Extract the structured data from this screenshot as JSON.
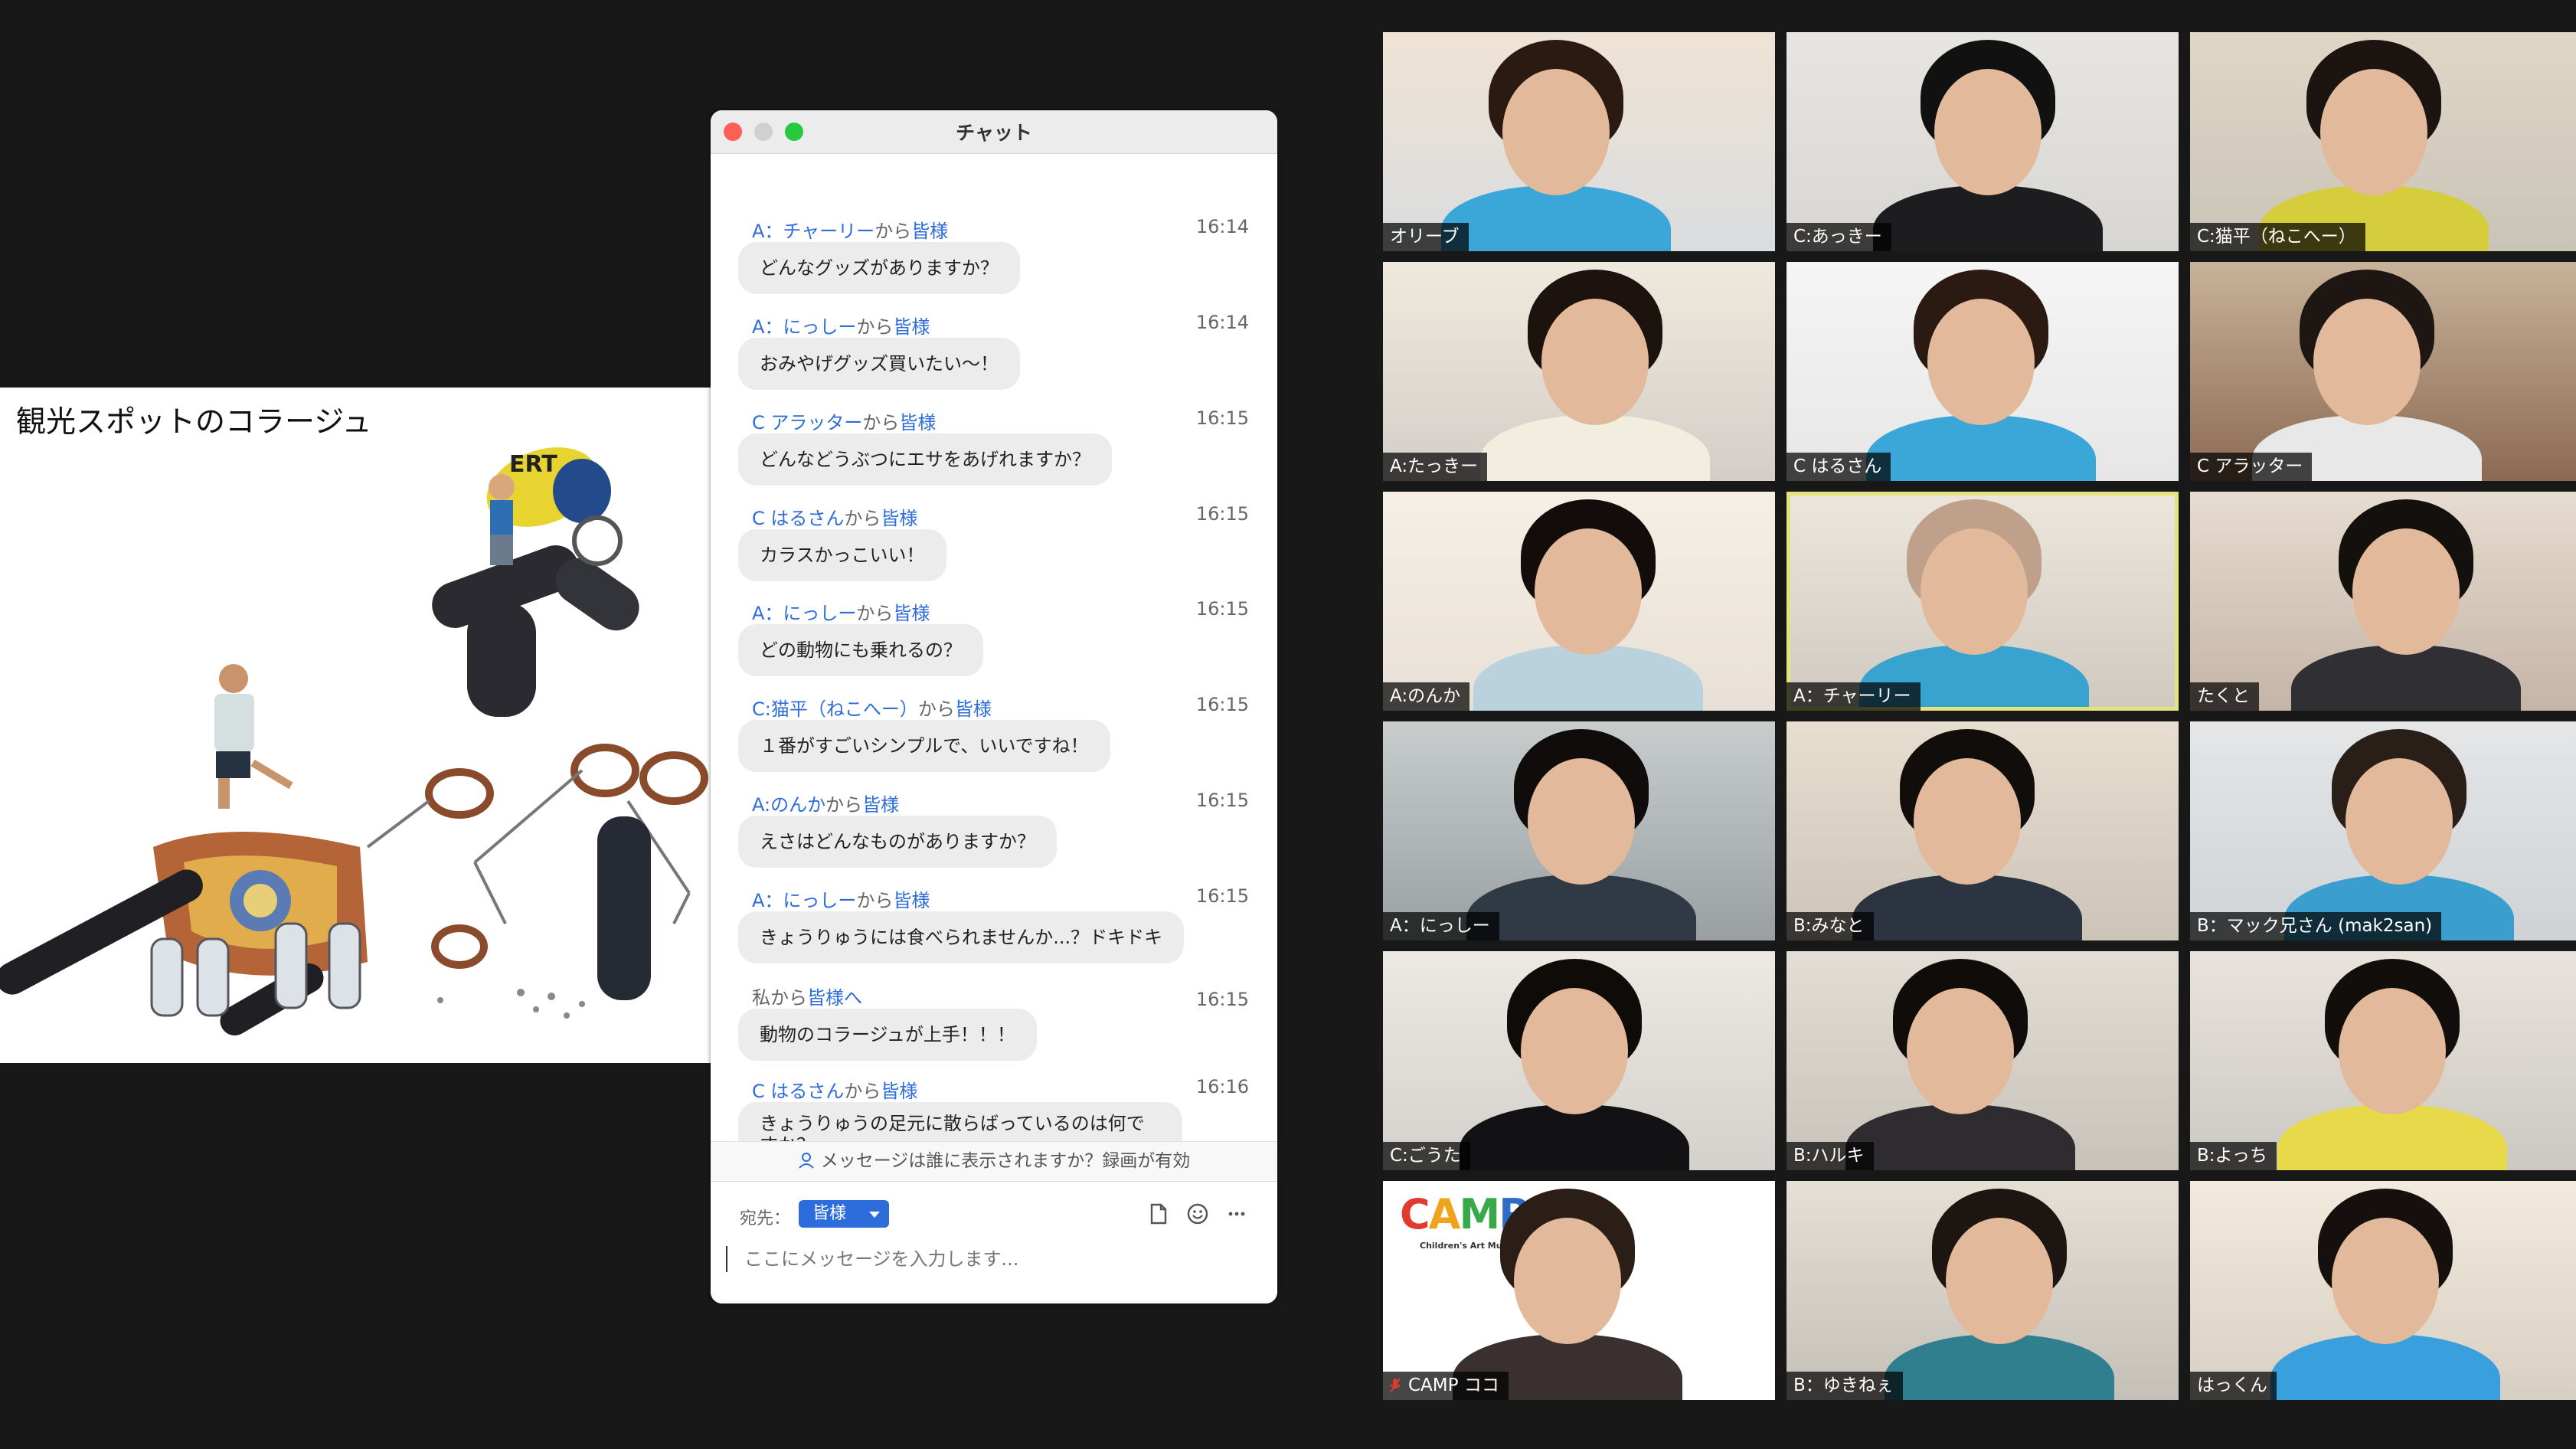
{
  "slide": {
    "title": "観光スポットのコラージュ"
  },
  "chat": {
    "window_title": "チャット",
    "messages": [
      {
        "sender": "A：チャーリー",
        "mid": "から",
        "rcpt": "皆様",
        "time": "16:14",
        "text": "どんなグッズがありますか？"
      },
      {
        "sender": "A：にっしー",
        "mid": "から",
        "rcpt": "皆様",
        "time": "16:14",
        "text": "おみやげグッズ買いたい〜！"
      },
      {
        "sender": "C アラッター",
        "mid": "から",
        "rcpt": "皆様",
        "time": "16:15",
        "text": "どんなどうぶつにエサをあげれますか？"
      },
      {
        "sender": "C はるさん",
        "mid": "から",
        "rcpt": "皆様",
        "time": "16:15",
        "text": "カラスかっこいい！"
      },
      {
        "sender": "A：にっしー",
        "mid": "から",
        "rcpt": "皆様",
        "time": "16:15",
        "text": "どの動物にも乗れるの？"
      },
      {
        "sender": "C:猫平（ねこへー）",
        "mid": "から",
        "rcpt": "皆様",
        "time": "16:15",
        "text": "１番がすごいシンプルで、いいですね！"
      },
      {
        "sender": "A:のんか",
        "mid": "から",
        "rcpt": "皆様",
        "time": "16:15",
        "text": "えさはどんなものがありますか？"
      },
      {
        "sender": "A：にっしー",
        "mid": "から",
        "rcpt": "皆様",
        "time": "16:15",
        "text": "きょうりゅうには食べられませんか...？ドキドキ"
      },
      {
        "sender": "",
        "mid": "私から",
        "rcpt": "皆様へ",
        "time": "16:15",
        "text": "動物のコラージュが上手！！！"
      },
      {
        "sender": "C はるさん",
        "mid": "から",
        "rcpt": "皆様",
        "time": "16:16",
        "text": "きょうりゅうの足元に散らばっているのは何ですか？"
      }
    ],
    "notice": "メッセージは誰に表示されますか？録画が有効",
    "to_label": "宛先：",
    "to_value": "皆様",
    "input_placeholder": "ここにメッセージを入力します..."
  },
  "participants": [
    {
      "name": "オリーブ"
    },
    {
      "name": "C:あっきー"
    },
    {
      "name": "C:猫平（ねこへー）"
    },
    {
      "name": "A:たっきー"
    },
    {
      "name": "C はるさん"
    },
    {
      "name": "C アラッター"
    },
    {
      "name": "A:のんか"
    },
    {
      "name": "A：チャーリー",
      "active": true
    },
    {
      "name": "たくと"
    },
    {
      "name": "A：にっしー"
    },
    {
      "name": "B:みなと"
    },
    {
      "name": "B：マック兄さん (mak2san)"
    },
    {
      "name": "C:ごうた"
    },
    {
      "name": "B:ハルキ"
    },
    {
      "name": "B:よっち"
    },
    {
      "name": "CAMP ココ",
      "muted": true
    },
    {
      "name": "B：ゆきねぇ"
    },
    {
      "name": "はっくん"
    }
  ],
  "camp_tile": {
    "logo": "CAMP",
    "subtitle": "Children's Art Museum & Park"
  },
  "colors": {
    "chat_link_blue": "#2d6cdb",
    "active_speaker_border": "#e5e47c",
    "background": "#181818"
  }
}
